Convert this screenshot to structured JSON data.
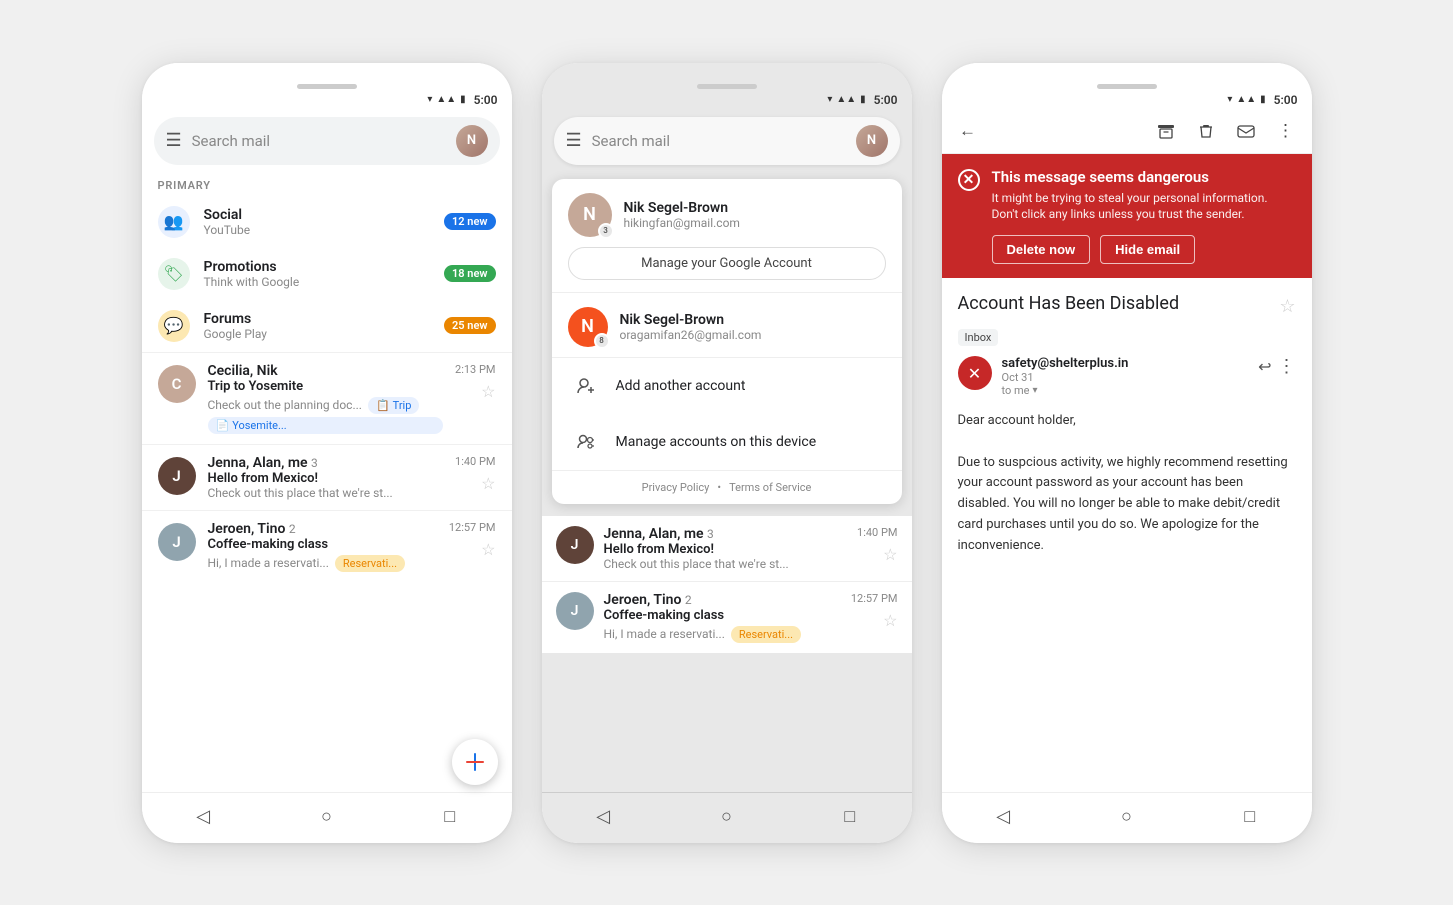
{
  "phone1": {
    "status": {
      "time": "5:00"
    },
    "search": {
      "placeholder": "Search mail"
    },
    "primary_label": "PRIMARY",
    "categories": [
      {
        "id": "social",
        "name": "Social",
        "sub": "YouTube",
        "badge": "12 new",
        "badge_class": "badge-blue",
        "icon": "👥",
        "icon_class": "cat-social"
      },
      {
        "id": "promotions",
        "name": "Promotions",
        "sub": "Think with Google",
        "badge": "18 new",
        "badge_class": "badge-green",
        "icon": "🏷",
        "icon_class": "cat-promo"
      },
      {
        "id": "forums",
        "name": "Forums",
        "sub": "Google Play",
        "badge": "25 new",
        "badge_class": "badge-orange",
        "icon": "💬",
        "icon_class": "cat-forum"
      }
    ],
    "emails": [
      {
        "from": "Cecilia, Nik",
        "subject": "Trip to Yosemite",
        "preview": "Check out the planning doc...",
        "time": "2:13 PM",
        "label": "Trip",
        "label2": "Yosemite...",
        "avatar_bg": "#c5a898",
        "avatar_text": "C"
      },
      {
        "from": "Jenna, Alan, me",
        "count": "3",
        "subject": "Hello from Mexico!",
        "preview": "Check out this place that we're st...",
        "time": "1:40 PM",
        "avatar_bg": "#5f4339",
        "avatar_text": "J"
      },
      {
        "from": "Jeroen, Tino",
        "count": "2",
        "subject": "Coffee-making class",
        "preview": "Hi, I made a reservati...",
        "time": "12:57 PM",
        "label": "Reservati...",
        "avatar_bg": "#90a4ae",
        "avatar_text": "J"
      }
    ],
    "fab_label": "+"
  },
  "phone2": {
    "status": {
      "time": "5:00"
    },
    "search": {
      "placeholder": "Search mail"
    },
    "account_primary": {
      "name": "Nik Segel-Brown",
      "email": "hikingfan@gmail.com",
      "avatar_text": "N",
      "manage_btn": "Manage your Google Account"
    },
    "account_secondary": {
      "name": "Nik Segel-Brown",
      "email": "oragamifan26@gmail.com",
      "avatar_text": "N",
      "avatar_bg": "#f4511e"
    },
    "actions": [
      {
        "label": "Add another account",
        "icon": "👤+"
      },
      {
        "label": "Manage accounts on this device",
        "icon": "⚙"
      }
    ],
    "footer": {
      "privacy": "Privacy Policy",
      "terms": "Terms of Service",
      "sep": "•"
    },
    "emails": [
      {
        "from": "Jenna, Alan, me",
        "count": "3",
        "subject": "Hello from Mexico!",
        "preview": "Check out this place that we're st...",
        "time": "1:40 PM",
        "avatar_bg": "#5f4339",
        "avatar_text": "J"
      },
      {
        "from": "Jeroen, Tino",
        "count": "2",
        "subject": "Coffee-making class",
        "preview": "Hi, I made a reservati...",
        "time": "12:57 PM",
        "label": "Reservati...",
        "avatar_bg": "#90a4ae",
        "avatar_text": "J"
      }
    ]
  },
  "phone3": {
    "status": {
      "time": "5:00"
    },
    "danger_banner": {
      "title": "This message seems dangerous",
      "desc": "It might be trying to steal your personal information. Don't click any links unless you trust the sender.",
      "btn1": "Delete now",
      "btn2": "Hide email"
    },
    "email": {
      "subject": "Account Has Been Disabled",
      "inbox_label": "Inbox",
      "sender_email": "safety@shelterplus.in",
      "date": "Oct 31",
      "to": "to me",
      "body": "Dear account holder,\n\nDue to suspcious activity, we highly recommend resetting your account password as your account has been disabled. You will no longer be able to make debit/credit card purchases until you do so. We apologize for the inconvenience."
    }
  }
}
